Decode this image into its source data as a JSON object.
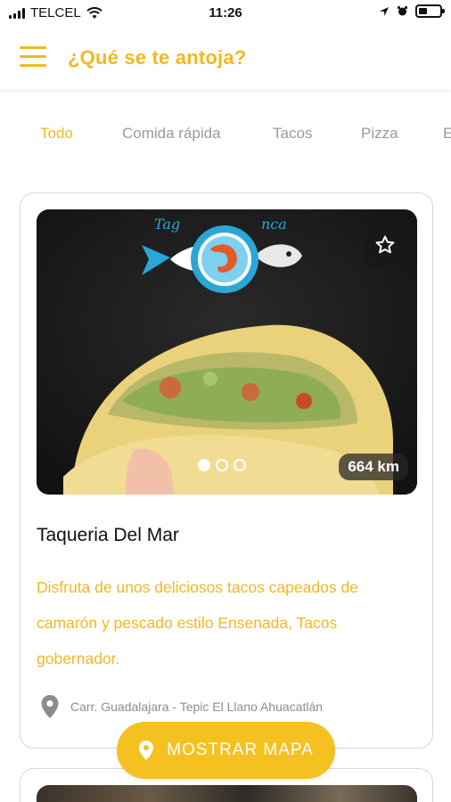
{
  "status_bar": {
    "carrier": "TELCEL",
    "time": "11:26",
    "battery_level": 0.4
  },
  "header": {
    "title": "¿Qué se te antoja?",
    "menu_icon": "hamburger-icon"
  },
  "tabs": [
    {
      "label": "Todo",
      "active": true
    },
    {
      "label": "Comida rápida",
      "active": false
    },
    {
      "label": "Tacos",
      "active": false
    },
    {
      "label": "Pizza",
      "active": false
    },
    {
      "label": "E",
      "active": false
    }
  ],
  "restaurant": {
    "name": "Taqueria Del Mar",
    "description": "Disfruta de unos deliciosos tacos capeados de camarón y pescado estilo Ensenada, Tacos gobernador.",
    "address": "Carr. Guadalajara - Tepic El Llano Ahuacatlán",
    "distance": "664 km",
    "image_count": 3,
    "current_image": 1
  },
  "map_button": {
    "label": "MOSTRAR MAPA",
    "icon": "location-pin-icon"
  },
  "colors": {
    "accent": "#f2b820",
    "button": "#f5c120",
    "muted_text": "#9a9a9a"
  }
}
